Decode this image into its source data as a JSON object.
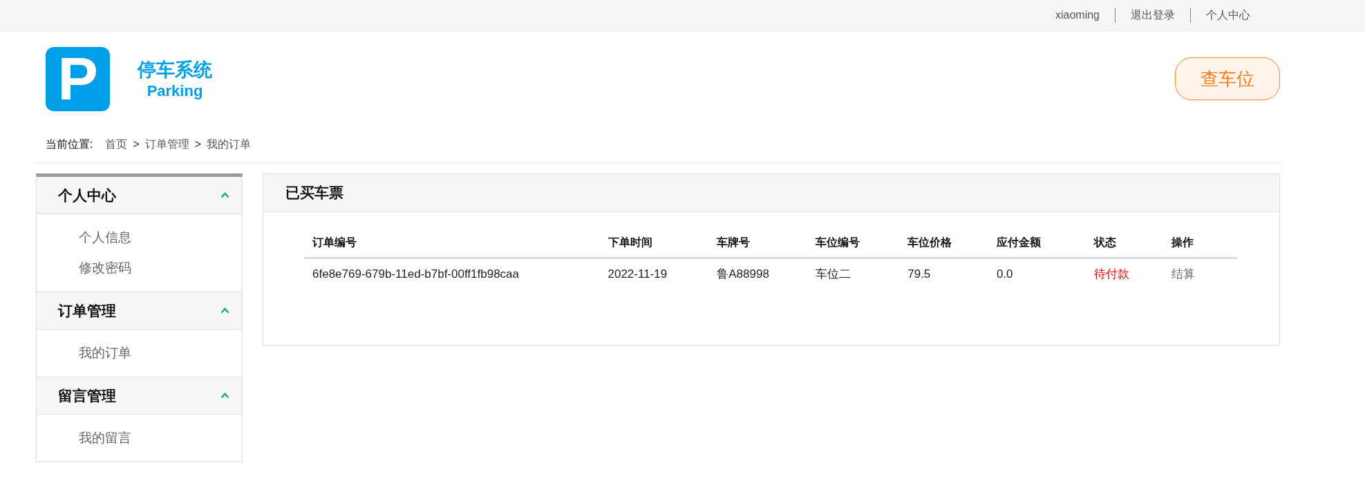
{
  "top_links": [
    "xiaoming",
    "退出登录",
    "个人中心"
  ],
  "logo": {
    "letter": "P",
    "title": "停车系统",
    "subtitle": "Parking"
  },
  "search_button": "查车位",
  "breadcrumb": {
    "label": "当前位置:",
    "items": [
      "首页",
      "订单管理",
      "我的订单"
    ],
    "separator": ">"
  },
  "sidebar": [
    {
      "title": "个人中心",
      "expanded": true,
      "items": [
        "个人信息",
        "修改密码"
      ]
    },
    {
      "title": "订单管理",
      "expanded": true,
      "items": [
        "我的订单"
      ]
    },
    {
      "title": "留言管理",
      "expanded": true,
      "items": [
        "我的留言"
      ]
    }
  ],
  "panel": {
    "title": "已买车票",
    "table": {
      "columns": [
        "订单编号",
        "下单时间",
        "车牌号",
        "车位编号",
        "车位价格",
        "应付金额",
        "状态",
        "操作"
      ],
      "rows": [
        {
          "cells": [
            "6fe8e769-679b-11ed-b7bf-00ff1fb98caa",
            "2022-11-19",
            "鲁A88998",
            "车位二",
            "79.5",
            "0.0"
          ],
          "status": {
            "text": "待付款",
            "color": "#ff0000"
          },
          "action": "结算"
        }
      ]
    }
  }
}
